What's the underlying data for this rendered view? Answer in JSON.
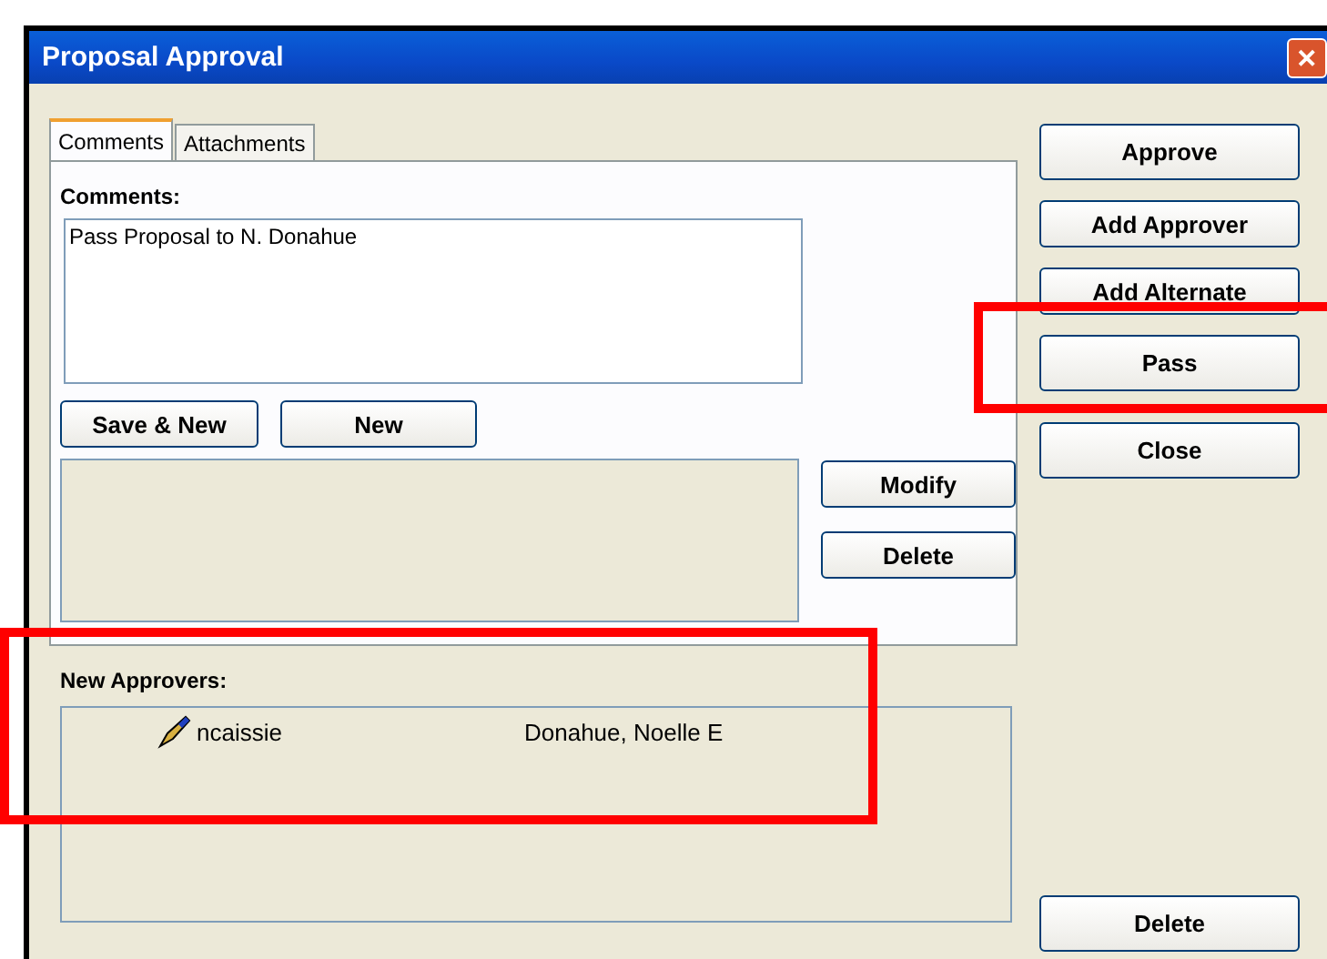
{
  "window": {
    "title": "Proposal Approval",
    "close": "✕"
  },
  "tabs": [
    {
      "label": "Comments",
      "selected": true
    },
    {
      "label": "Attachments",
      "selected": false
    }
  ],
  "comments": {
    "label": "Comments:",
    "value": "Pass Proposal to N. Donahue"
  },
  "comment_buttons": [
    "Save & New",
    "New"
  ],
  "list_buttons": [
    "Modify",
    "Delete"
  ],
  "new_approvers": {
    "label": "New Approvers:",
    "highlighted": true,
    "rows": [
      {
        "user": "ncaissie",
        "name": "Donahue, Noelle E"
      }
    ]
  },
  "side_buttons": [
    {
      "label": "Approve",
      "highlighted": false
    },
    {
      "label": "Add Approver",
      "highlighted": false
    },
    {
      "label": "Add Alternate",
      "highlighted": false
    },
    {
      "label": "Pass",
      "highlighted": true
    },
    {
      "label": "Close",
      "highlighted": false
    }
  ],
  "bottom_button": "Delete"
}
